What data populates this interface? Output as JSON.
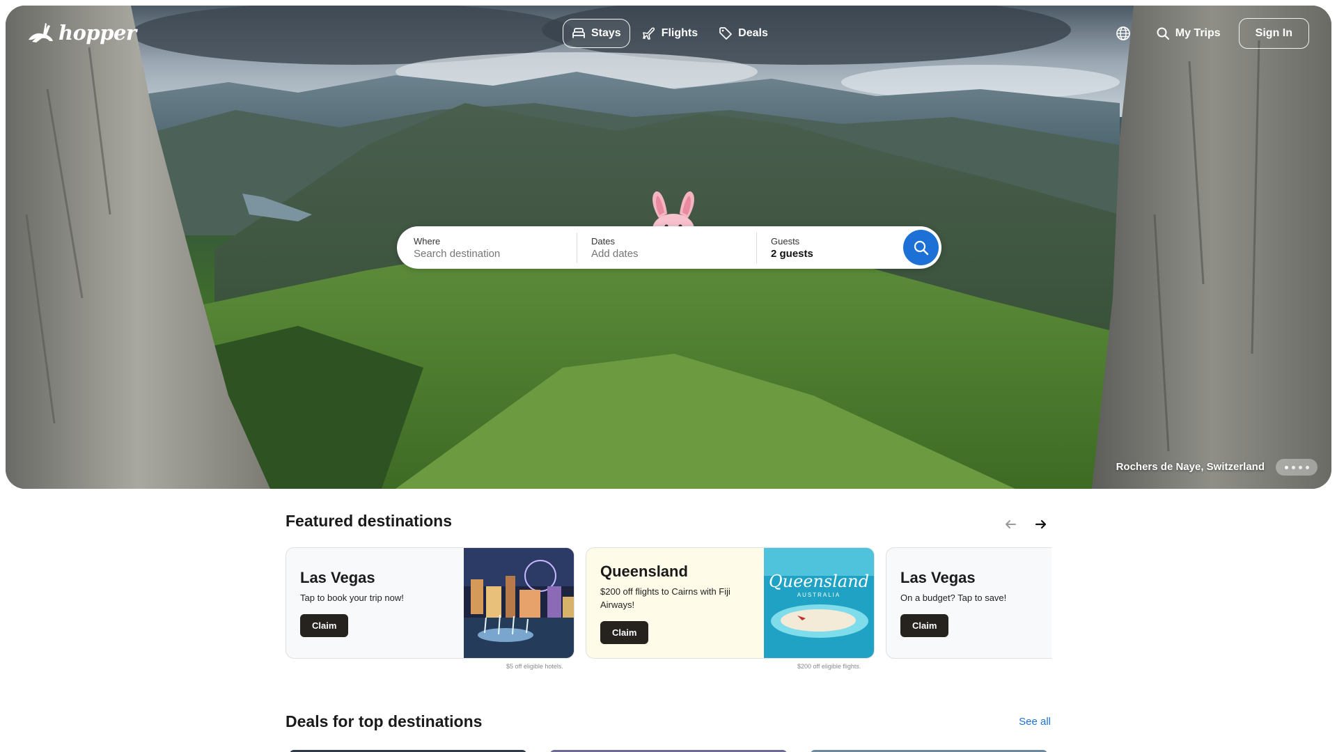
{
  "brand": {
    "name": "hopper"
  },
  "nav": {
    "items": [
      {
        "label": "Stays",
        "icon": "bed-icon",
        "active": true
      },
      {
        "label": "Flights",
        "icon": "plane-icon",
        "active": false
      },
      {
        "label": "Deals",
        "icon": "tag-icon",
        "active": false
      }
    ]
  },
  "header": {
    "my_trips": "My Trips",
    "sign_in": "Sign In",
    "globe_icon": "globe-icon",
    "search_icon": "search-icon"
  },
  "search": {
    "where_label": "Where",
    "where_placeholder": "Search destination",
    "dates_label": "Dates",
    "dates_placeholder": "Add dates",
    "guests_label": "Guests",
    "guests_value": "2 guests"
  },
  "hero": {
    "caption": "Rochers de Naye, Switzerland"
  },
  "featured": {
    "title": "Featured destinations",
    "cards": [
      {
        "title": "Las Vegas",
        "subtitle": "Tap to book your trip now!",
        "button": "Claim",
        "fine_print": "$5 off eligible hotels."
      },
      {
        "title": "Queensland",
        "subtitle": "$200 off flights to Cairns with Fiji Airways!",
        "button": "Claim",
        "fine_print": "$200 off eligible flights.",
        "image_text": "Queensland",
        "image_subtext": "AUSTRALIA"
      },
      {
        "title": "Las Vegas",
        "subtitle": "On a budget? Tap to save!",
        "button": "Claim"
      }
    ]
  },
  "deals": {
    "title": "Deals for top destinations",
    "see_all": "See all"
  },
  "colors": {
    "accent": "#1c70d6",
    "claim_button": "#26221d",
    "queensland_card": "#fffbe9"
  }
}
